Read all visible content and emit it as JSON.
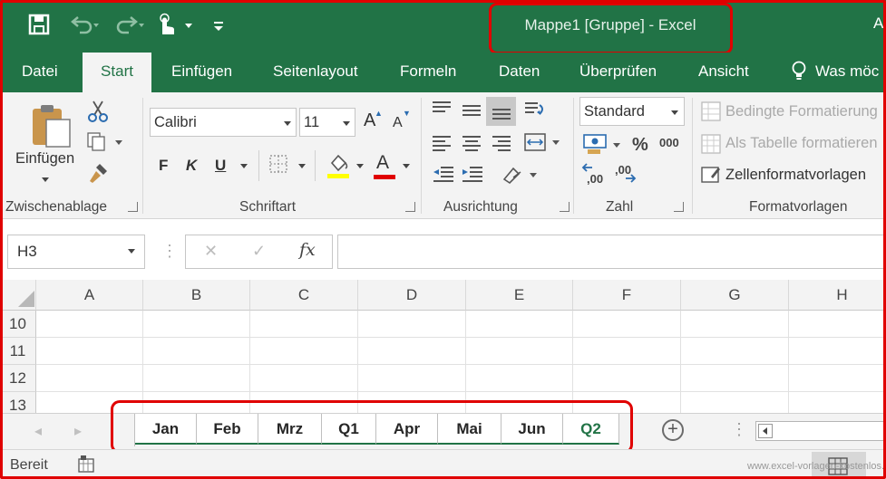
{
  "title_bar": {
    "title": "Mappe1  [Gruppe]  -  Excel",
    "right_text": "A",
    "icons": [
      "save-icon",
      "undo-icon",
      "redo-icon",
      "touch-mode-icon",
      "customize-icon"
    ]
  },
  "tabs": [
    {
      "label": "Datei"
    },
    {
      "label": "Start"
    },
    {
      "label": "Einfügen"
    },
    {
      "label": "Seitenlayout"
    },
    {
      "label": "Formeln"
    },
    {
      "label": "Daten"
    },
    {
      "label": "Überprüfen"
    },
    {
      "label": "Ansicht"
    },
    {
      "label": "Was möc"
    }
  ],
  "ribbon": {
    "clipboard": {
      "label": "Zwischenablage",
      "paste": "Einfügen"
    },
    "font": {
      "label": "Schriftart",
      "family": "Calibri",
      "size": "11",
      "bold": "F",
      "italic": "K",
      "underline": "U",
      "grow": "A",
      "shrink": "A",
      "color": "A"
    },
    "alignment": {
      "label": "Ausrichtung"
    },
    "number": {
      "label": "Zahl",
      "format": "Standard",
      "percent": "%",
      "thousands": "000",
      "inc_decimals": ",00",
      "dec_decimals": ",00"
    },
    "styles": {
      "label": "Formatvorlagen",
      "conditional": "Bedingte Formatierung",
      "as_table": "Als Tabelle formatieren",
      "cell_styles": "Zellenformatvorlagen"
    }
  },
  "formula_bar": {
    "name_box": "H3",
    "fx": "fx",
    "cancel": "✕",
    "enter": "✓",
    "value": ""
  },
  "grid": {
    "columns": [
      "A",
      "B",
      "C",
      "D",
      "E",
      "F",
      "G",
      "H"
    ],
    "rows": [
      "10",
      "11",
      "12",
      "13"
    ]
  },
  "sheets": [
    {
      "name": "Jan",
      "active": false
    },
    {
      "name": "Feb",
      "active": false
    },
    {
      "name": "Mrz",
      "active": false
    },
    {
      "name": "Q1",
      "active": false
    },
    {
      "name": "Apr",
      "active": false
    },
    {
      "name": "Mai",
      "active": false
    },
    {
      "name": "Jun",
      "active": false
    },
    {
      "name": "Q2",
      "active": true
    }
  ],
  "status": {
    "text": "Bereit",
    "watermark": "www.excel-vorlagen-kostenlos.de"
  },
  "colors": {
    "excel_green": "#217346",
    "highlight_red": "#e00000",
    "ribbon_bg": "#f3f3f3"
  }
}
